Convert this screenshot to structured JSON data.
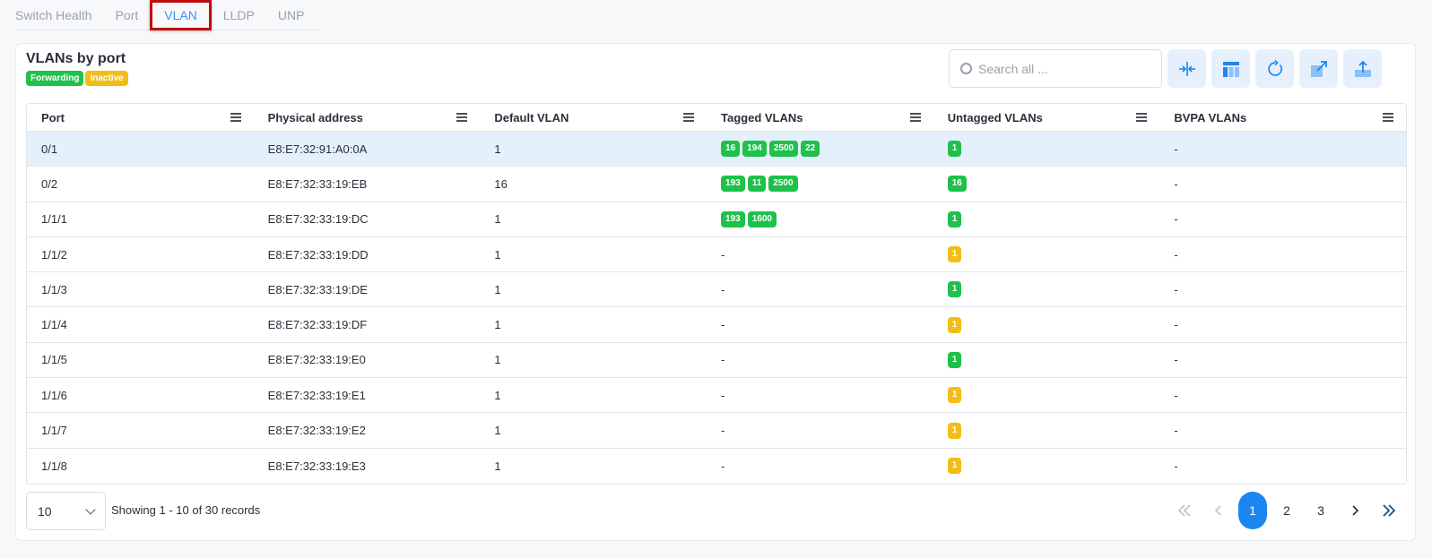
{
  "tabs": [
    {
      "label": "Switch Health",
      "active": false
    },
    {
      "label": "Port",
      "active": false
    },
    {
      "label": "VLAN",
      "active": true
    },
    {
      "label": "LLDP",
      "active": false
    },
    {
      "label": "UNP",
      "active": false
    }
  ],
  "card": {
    "title": "VLANs by port",
    "legend": {
      "forwarding": "Forwarding",
      "inactive": "Inactive"
    }
  },
  "search": {
    "placeholder": "Search all ..."
  },
  "toolbar": [
    "collapse-icon",
    "columns-icon",
    "refresh-icon",
    "expand-icon",
    "export-icon"
  ],
  "colors": {
    "forwarding": "#1ec14a",
    "inactive": "#f3bd13",
    "accent": "#1a86f0",
    "highlight": "#c00d0d"
  },
  "table": {
    "columns": [
      "Port",
      "Physical address",
      "Default VLAN",
      "Tagged VLANs",
      "Untagged VLANs",
      "BVPA VLANs"
    ],
    "rows": [
      {
        "port": "0/1",
        "mac": "E8:E7:32:91:A0:0A",
        "default_vlan": "1",
        "tagged": [
          "16",
          "194",
          "2500",
          "22"
        ],
        "untagged": {
          "value": "1",
          "status": "forwarding"
        },
        "bvpa": "-"
      },
      {
        "port": "0/2",
        "mac": "E8:E7:32:33:19:EB",
        "default_vlan": "16",
        "tagged": [
          "193",
          "11",
          "2500"
        ],
        "untagged": {
          "value": "16",
          "status": "forwarding"
        },
        "bvpa": "-"
      },
      {
        "port": "1/1/1",
        "mac": "E8:E7:32:33:19:DC",
        "default_vlan": "1",
        "tagged": [
          "193",
          "1600"
        ],
        "untagged": {
          "value": "1",
          "status": "forwarding"
        },
        "bvpa": "-"
      },
      {
        "port": "1/1/2",
        "mac": "E8:E7:32:33:19:DD",
        "default_vlan": "1",
        "tagged": [],
        "untagged": {
          "value": "1",
          "status": "inactive"
        },
        "bvpa": "-"
      },
      {
        "port": "1/1/3",
        "mac": "E8:E7:32:33:19:DE",
        "default_vlan": "1",
        "tagged": [],
        "untagged": {
          "value": "1",
          "status": "forwarding"
        },
        "bvpa": "-"
      },
      {
        "port": "1/1/4",
        "mac": "E8:E7:32:33:19:DF",
        "default_vlan": "1",
        "tagged": [],
        "untagged": {
          "value": "1",
          "status": "inactive"
        },
        "bvpa": "-"
      },
      {
        "port": "1/1/5",
        "mac": "E8:E7:32:33:19:E0",
        "default_vlan": "1",
        "tagged": [],
        "untagged": {
          "value": "1",
          "status": "forwarding"
        },
        "bvpa": "-"
      },
      {
        "port": "1/1/6",
        "mac": "E8:E7:32:33:19:E1",
        "default_vlan": "1",
        "tagged": [],
        "untagged": {
          "value": "1",
          "status": "inactive"
        },
        "bvpa": "-"
      },
      {
        "port": "1/1/7",
        "mac": "E8:E7:32:33:19:E2",
        "default_vlan": "1",
        "tagged": [],
        "untagged": {
          "value": "1",
          "status": "inactive"
        },
        "bvpa": "-"
      },
      {
        "port": "1/1/8",
        "mac": "E8:E7:32:33:19:E3",
        "default_vlan": "1",
        "tagged": [],
        "untagged": {
          "value": "1",
          "status": "inactive"
        },
        "bvpa": "-"
      }
    ],
    "empty_text": "-"
  },
  "footer": {
    "page_size": "10",
    "records_text": "Showing 1 - 10 of 30 records",
    "pages": [
      "1",
      "2",
      "3"
    ],
    "current_page": "1"
  }
}
